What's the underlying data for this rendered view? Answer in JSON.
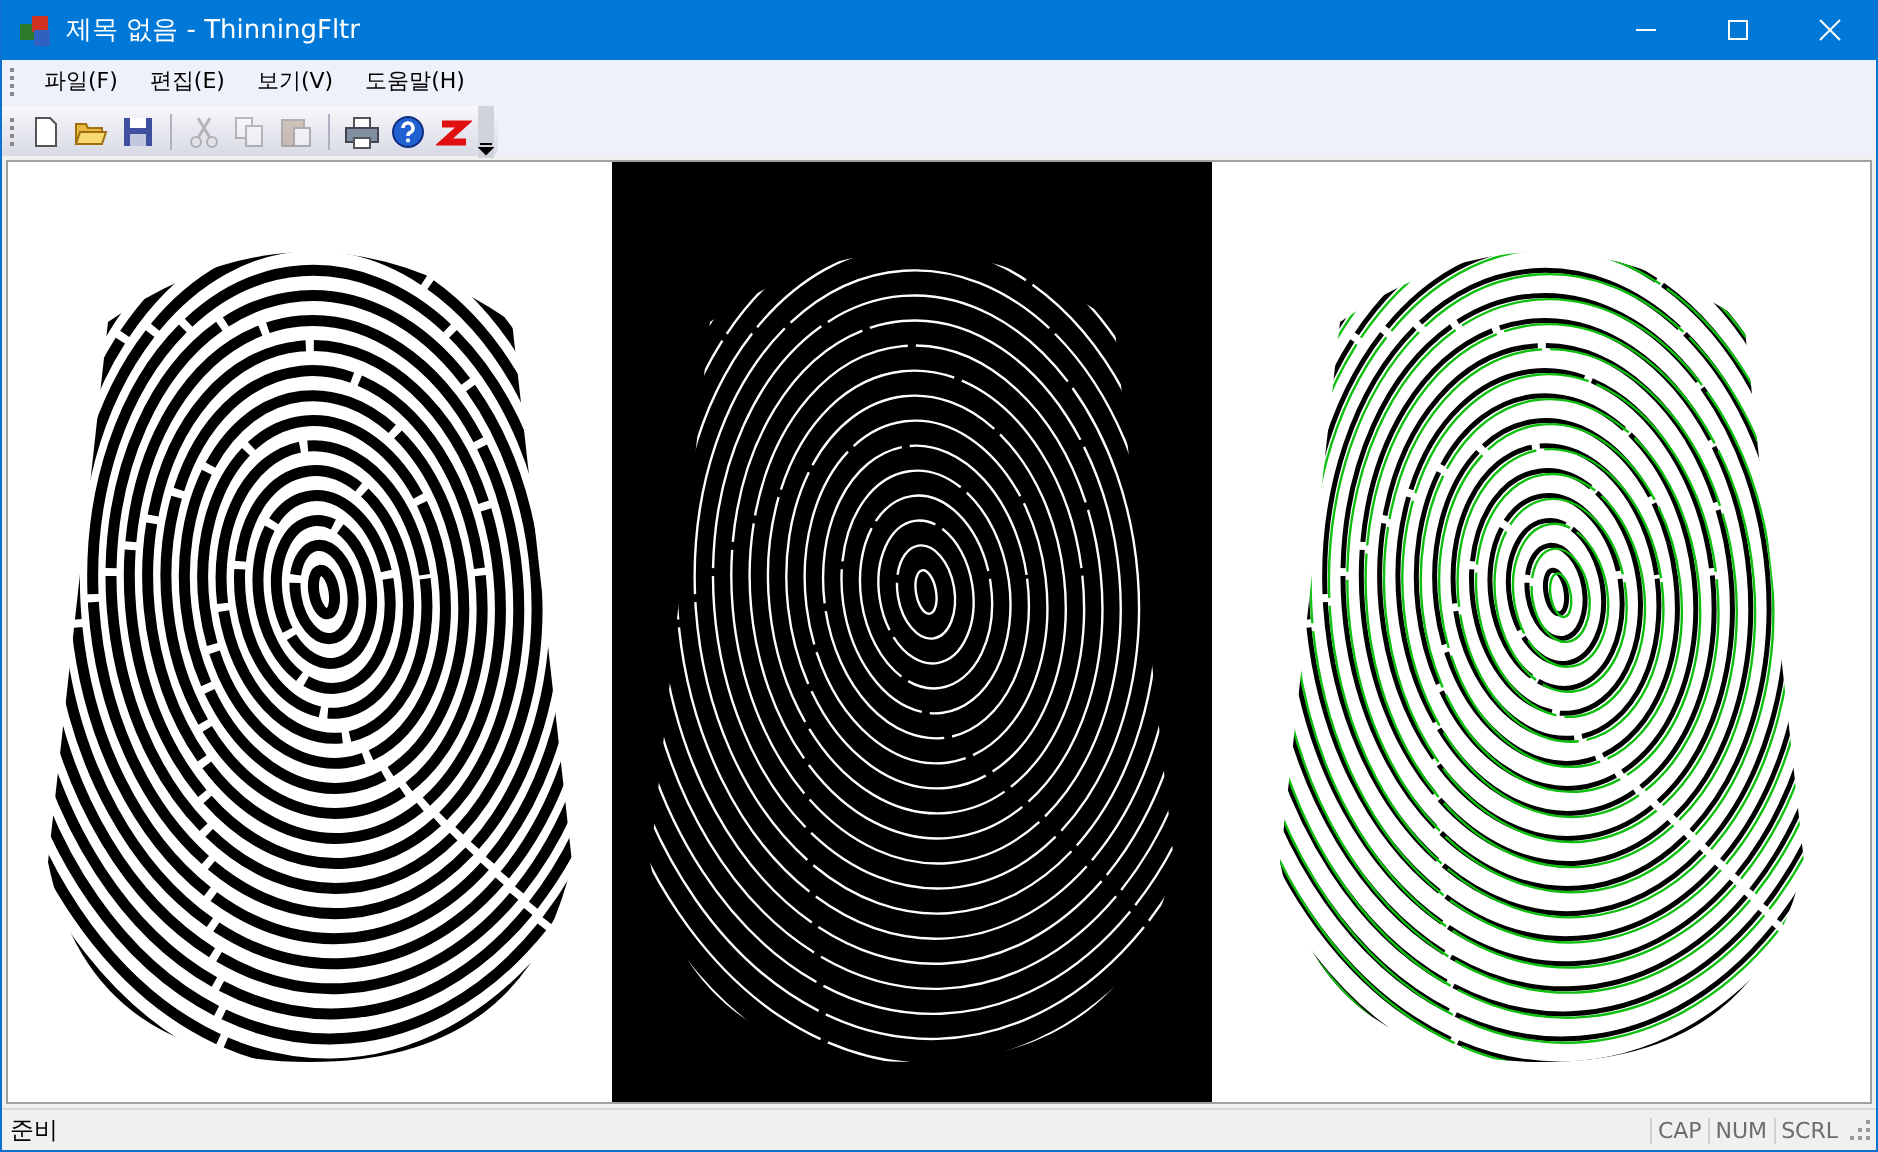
{
  "window": {
    "title": "제목 없음 - ThinningFltr"
  },
  "menu": [
    {
      "label": "파일(F)"
    },
    {
      "label": "편집(E)"
    },
    {
      "label": "보기(V)"
    },
    {
      "label": "도움말(H)"
    }
  ],
  "toolbar": [
    {
      "kind": "new",
      "disabled": false
    },
    {
      "kind": "open",
      "disabled": false
    },
    {
      "kind": "save",
      "disabled": false
    },
    {
      "kind": "sep"
    },
    {
      "kind": "cut",
      "disabled": true
    },
    {
      "kind": "copy",
      "disabled": true
    },
    {
      "kind": "paste",
      "disabled": true
    },
    {
      "kind": "sep"
    },
    {
      "kind": "print",
      "disabled": false
    },
    {
      "kind": "help",
      "disabled": false
    },
    {
      "kind": "z",
      "disabled": false
    }
  ],
  "panels": [
    {
      "kind": "binary"
    },
    {
      "kind": "skeleton"
    },
    {
      "kind": "overlay"
    }
  ],
  "status_bar": {
    "text": "준비",
    "indicators": [
      "CAP",
      "NUM",
      "SCRL"
    ]
  }
}
